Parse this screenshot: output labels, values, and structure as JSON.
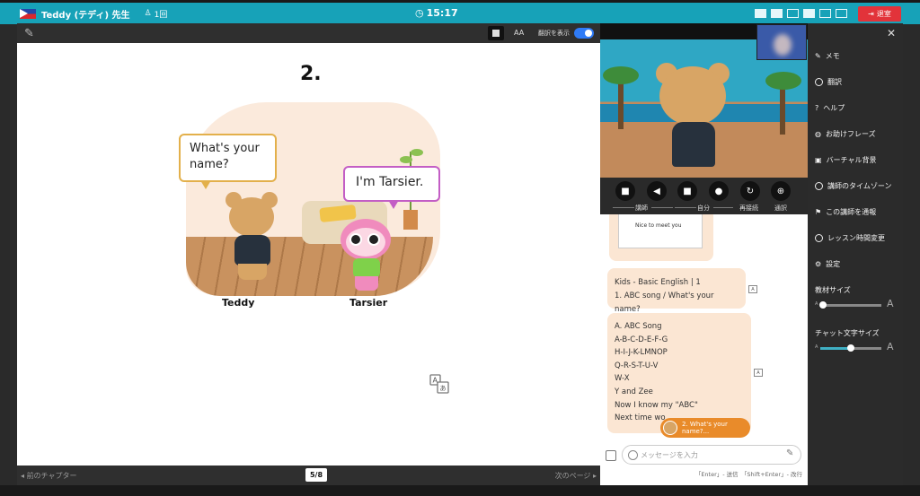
{
  "topbar": {
    "teacher_name": "Teddy (テディ) 先生",
    "lesson_count": "1回",
    "timer": "15:17",
    "leave_label": "退室",
    "colors": {
      "bar": "#17a2b8",
      "leave": "#e2333a"
    }
  },
  "slide_toolbar": {
    "font_size_label": "AA",
    "translation_label": "翻訳を表示",
    "translation_on": true
  },
  "slide": {
    "number": "2.",
    "bubble_teddy": "What's your name?",
    "bubble_tarsier": "I'm Tarsier.",
    "name_teddy": "Teddy",
    "name_tarsier": "Tarsier"
  },
  "slide_footer": {
    "prev_label": "前のチャプター",
    "page": "5/8",
    "next_label": "次のページ"
  },
  "controls": {
    "teacher_label": "講師",
    "self_label": "自分",
    "reconnect_label": "再接続",
    "interpret_label": "通訳"
  },
  "chat": {
    "image_caption": "Nice to meet you",
    "message1": {
      "line1": "Kids - Basic English | 1",
      "line2": "1. ABC song / What's your name?"
    },
    "message2": {
      "lines": [
        "A. ABC Song",
        "A-B-C-D-E-F-G",
        "H-I-J-K-LMNOP",
        "Q-R-S-T-U-V",
        "W-X",
        "Y and Zee",
        "Now I know my \"ABC\"",
        "Next time wo"
      ]
    },
    "suggestion": "2. What's your name?...",
    "input_placeholder": "メッセージを入力",
    "hint": "「Enter」- 送信　「Shift+Enter」- 改行"
  },
  "sidebar": {
    "items": [
      {
        "label": "メモ",
        "icon": "memo-icon"
      },
      {
        "label": "翻訳",
        "icon": "globe-icon"
      },
      {
        "label": "ヘルプ",
        "icon": "help-icon"
      },
      {
        "label": "お助けフレーズ",
        "icon": "chat-bubble-icon"
      },
      {
        "label": "バーチャル背景",
        "icon": "image-icon"
      },
      {
        "label": "講師のタイムゾーン",
        "icon": "globe-icon"
      },
      {
        "label": "この講師を通報",
        "icon": "flag-icon"
      },
      {
        "label": "レッスン時間変更",
        "icon": "clock-icon"
      },
      {
        "label": "設定",
        "icon": "gear-icon"
      }
    ],
    "material_size_label": "教材サイズ",
    "material_size_value": 0.05,
    "chat_size_label": "チャット文字サイズ",
    "chat_size_value": 0.5,
    "slider_small": "A",
    "slider_big": "A"
  }
}
